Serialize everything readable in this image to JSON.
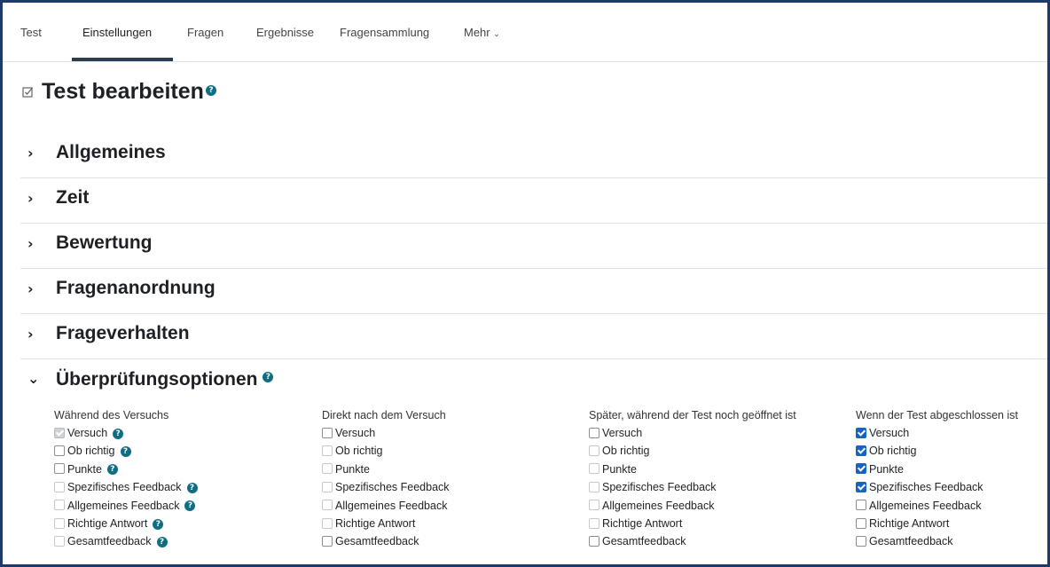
{
  "tabs": [
    "Test",
    "Einstellungen",
    "Fragen",
    "Ergebnisse",
    "Fragensammlung",
    "Mehr"
  ],
  "active_tab": "Einstellungen",
  "more_chevron": "chevron-down-icon",
  "page_title": "Test bearbeiten",
  "sections": [
    {
      "label": "Allgemeines",
      "expanded": false
    },
    {
      "label": "Zeit",
      "expanded": false
    },
    {
      "label": "Bewertung",
      "expanded": false
    },
    {
      "label": "Fragenanordnung",
      "expanded": false
    },
    {
      "label": "Frageverhalten",
      "expanded": false
    },
    {
      "label": "Überprüfungsoptionen",
      "expanded": true
    }
  ],
  "review_columns": [
    {
      "heading": "Während des Versuchs",
      "options": [
        {
          "label": "Versuch",
          "state": "checked-disabled",
          "help": true
        },
        {
          "label": "Ob richtig",
          "state": "unchecked",
          "help": true
        },
        {
          "label": "Punkte",
          "state": "unchecked",
          "help": true
        },
        {
          "label": "Spezifisches Feedback",
          "state": "unchecked-faded",
          "help": true
        },
        {
          "label": "Allgemeines Feedback",
          "state": "unchecked-faded",
          "help": true
        },
        {
          "label": "Richtige Antwort",
          "state": "unchecked-faded",
          "help": true
        },
        {
          "label": "Gesamtfeedback",
          "state": "unchecked-faded",
          "help": true
        }
      ]
    },
    {
      "heading": "Direkt nach dem Versuch",
      "options": [
        {
          "label": "Versuch",
          "state": "unchecked"
        },
        {
          "label": "Ob richtig",
          "state": "unchecked-faded"
        },
        {
          "label": "Punkte",
          "state": "unchecked-faded"
        },
        {
          "label": "Spezifisches Feedback",
          "state": "unchecked-faded"
        },
        {
          "label": "Allgemeines Feedback",
          "state": "unchecked-faded"
        },
        {
          "label": "Richtige Antwort",
          "state": "unchecked-faded"
        },
        {
          "label": "Gesamtfeedback",
          "state": "unchecked"
        }
      ]
    },
    {
      "heading": "Später, während der Test noch geöffnet ist",
      "options": [
        {
          "label": "Versuch",
          "state": "unchecked"
        },
        {
          "label": "Ob richtig",
          "state": "unchecked-faded"
        },
        {
          "label": "Punkte",
          "state": "unchecked-faded"
        },
        {
          "label": "Spezifisches Feedback",
          "state": "unchecked-faded"
        },
        {
          "label": "Allgemeines Feedback",
          "state": "unchecked-faded"
        },
        {
          "label": "Richtige Antwort",
          "state": "unchecked-faded"
        },
        {
          "label": "Gesamtfeedback",
          "state": "unchecked"
        }
      ]
    },
    {
      "heading": "Wenn der Test abgeschlossen ist",
      "options": [
        {
          "label": "Versuch",
          "state": "checked"
        },
        {
          "label": "Ob richtig",
          "state": "checked"
        },
        {
          "label": "Punkte",
          "state": "checked"
        },
        {
          "label": "Spezifisches Feedback",
          "state": "checked"
        },
        {
          "label": "Allgemeines Feedback",
          "state": "unchecked"
        },
        {
          "label": "Richtige Antwort",
          "state": "unchecked"
        },
        {
          "label": "Gesamtfeedback",
          "state": "unchecked"
        }
      ]
    }
  ],
  "colors": {
    "accent": "#1565c0",
    "help": "#0f6e84",
    "border": "#1e3a6b"
  }
}
